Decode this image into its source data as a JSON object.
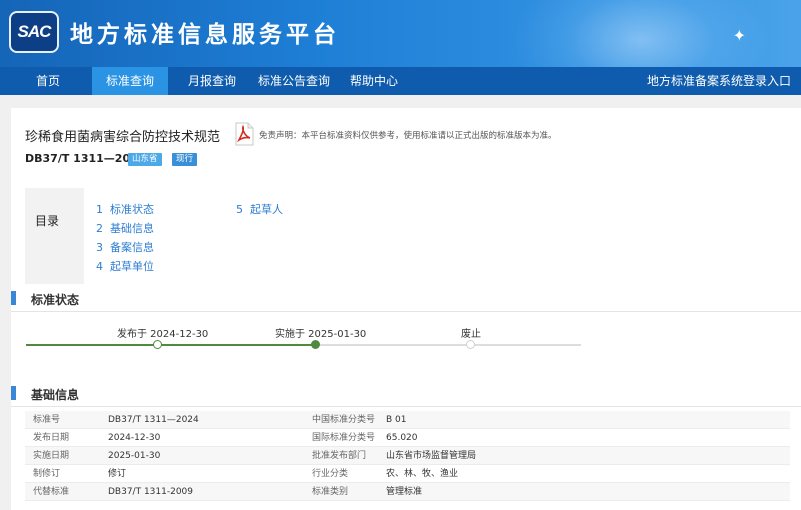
{
  "header": {
    "logo_text": "SAC",
    "site_title": "地方标准信息服务平台"
  },
  "nav": {
    "items": [
      {
        "label": "首页"
      },
      {
        "label": "标准查询"
      },
      {
        "label": "月报查询"
      },
      {
        "label": "标准公告查询"
      },
      {
        "label": "帮助中心"
      }
    ],
    "active_index": 1,
    "right_link": "地方标准备案系统登录入口"
  },
  "standard": {
    "name": "珍稀食用菌病害综合防控技术规范",
    "disclaimer": "免责声明：本平台标准资料仅供参考，使用标准请以正式出版的标准版本为准。",
    "code": "DB37/T 1311—2024",
    "region_badge": "山东省",
    "status_badge": "现行"
  },
  "toc": {
    "label": "目录",
    "items": [
      {
        "num": "1",
        "label": "标准状态"
      },
      {
        "num": "2",
        "label": "基础信息"
      },
      {
        "num": "3",
        "label": "备案信息"
      },
      {
        "num": "4",
        "label": "起草单位"
      },
      {
        "num": "5",
        "label": "起草人"
      }
    ]
  },
  "status_section": {
    "title": "标准状态",
    "milestones": [
      {
        "label": "发布于 2024-12-30",
        "state": "done"
      },
      {
        "label": "实施于 2025-01-30",
        "state": "current"
      },
      {
        "label": "废止",
        "state": "future"
      }
    ]
  },
  "basic_section": {
    "title": "基础信息",
    "rows": [
      {
        "k1": "标准号",
        "v1": "DB37/T 1311—2024",
        "k2": "中国标准分类号",
        "v2": "B 01"
      },
      {
        "k1": "发布日期",
        "v1": "2024-12-30",
        "k2": "国际标准分类号",
        "v2": "65.020"
      },
      {
        "k1": "实施日期",
        "v1": "2025-01-30",
        "k2": "批准发布部门",
        "v2": "山东省市场监督管理局"
      },
      {
        "k1": "制修订",
        "v1": "修订",
        "k2": "行业分类",
        "v2": "农、林、牧、渔业"
      },
      {
        "k1": "代替标准",
        "v1": "DB37/T 1311-2009",
        "k2": "标准类别",
        "v2": "管理标准"
      }
    ]
  },
  "colors": {
    "nav_bg": "#0f5cae",
    "nav_active": "#2a93e4",
    "link": "#2d7dd2",
    "timeline_done": "#4f8a3e"
  }
}
